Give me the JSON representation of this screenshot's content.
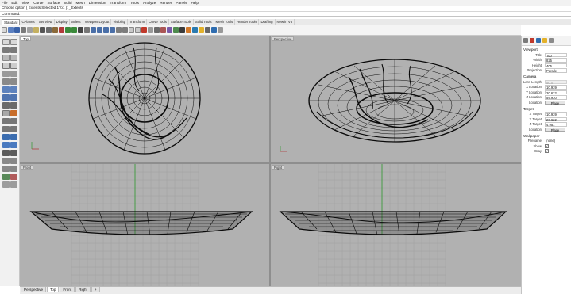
{
  "menubar": {
    "items": [
      "File",
      "Edit",
      "View",
      "Curve",
      "Surface",
      "Solid",
      "Mesh",
      "Dimension",
      "Transform",
      "Tools",
      "Analyze",
      "Render",
      "Panels",
      "Help"
    ]
  },
  "command": {
    "history": "Choose option ( Extents Selected 1To1 ): _Extents",
    "prompt": "Command:"
  },
  "toolbar_tabs": {
    "items": [
      "Standard",
      "CPlanes",
      "Set View",
      "Display",
      "Select",
      "Viewport Layout",
      "Visibility",
      "Transform",
      "Curve Tools",
      "Surface Tools",
      "Solid Tools",
      "Mesh Tools",
      "Render Tools",
      "Drafting",
      "New in V5"
    ],
    "active": "Standard"
  },
  "viewports": {
    "top": "Top",
    "perspective": "Perspective",
    "front": "Front",
    "right": "Right"
  },
  "bottom_tabs": {
    "items": [
      "Perspective",
      "Top",
      "Front",
      "Right"
    ],
    "active": "Top",
    "add": "+"
  },
  "properties": {
    "viewport_header": "Viewport",
    "title_label": "Title",
    "title_value": "Top",
    "width_label": "Width",
    "width_value": "825",
    "height_label": "Height",
    "height_value": "405",
    "projection_label": "Projection",
    "projection_value": "Parallel",
    "camera_header": "Camera",
    "lens_label": "Lens Length",
    "lens_value": "50.0",
    "xloc_label": "X Location",
    "xloc_value": "10.939",
    "yloc_label": "Y Location",
    "yloc_value": "20.622",
    "zloc_label": "Z Location",
    "zloc_value": "59.930",
    "location_label": "Location",
    "place_button": "Place",
    "target_header": "Target",
    "xtarget_label": "X Target",
    "xtarget_value": "10.939",
    "ytarget_label": "Y Target",
    "ytarget_value": "20.622",
    "ztarget_label": "Z Target",
    "ztarget_value": "4.951",
    "target_location_label": "Location",
    "target_place_button": "Place",
    "wallpaper_header": "Wallpaper",
    "filename_label": "Filename",
    "filename_value": "(none)",
    "show_label": "Show",
    "gray_label": "Gray"
  },
  "colors": {
    "viewport_bg": "#b1b1b1",
    "wire": "#0a0a0a",
    "grid": "#9c9c9c",
    "y_axis": "#2e9a2e",
    "x_axis": "#b03030"
  }
}
